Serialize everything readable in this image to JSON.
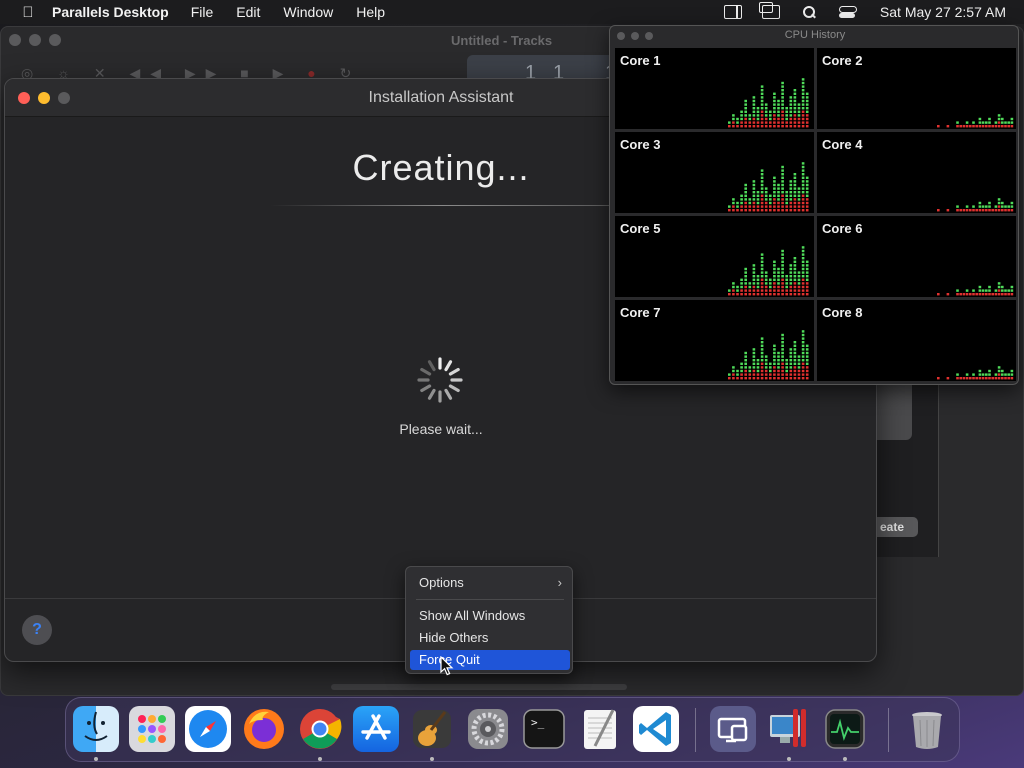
{
  "menubar": {
    "app_name": "Parallels Desktop",
    "items": [
      "File",
      "Edit",
      "Window",
      "Help"
    ],
    "clock": "Sat May 27  2:57 AM"
  },
  "background_window": {
    "title": "Untitled - Tracks",
    "lcd_values": [
      "1",
      "1",
      "1"
    ],
    "create_label": "eate"
  },
  "install_window": {
    "title": "Installation Assistant",
    "heading": "Creating...",
    "status": "Please wait...",
    "help_label": "?"
  },
  "cpu_history": {
    "title": "CPU History",
    "cores": [
      {
        "label": "Core 1",
        "load": "high"
      },
      {
        "label": "Core 2",
        "load": "low"
      },
      {
        "label": "Core 3",
        "load": "high"
      },
      {
        "label": "Core 4",
        "load": "low"
      },
      {
        "label": "Core 5",
        "load": "high"
      },
      {
        "label": "Core 6",
        "load": "low"
      },
      {
        "label": "Core 7",
        "load": "high"
      },
      {
        "label": "Core 8",
        "load": "low"
      }
    ],
    "colors": {
      "user": "#4fdb5a",
      "system": "#e0312f",
      "background": "#000000"
    }
  },
  "context_menu": {
    "items": [
      {
        "label": "Options",
        "submenu": true
      },
      {
        "label": "Show All Windows"
      },
      {
        "label": "Hide Others"
      },
      {
        "label": "Force Quit",
        "selected": true
      }
    ]
  },
  "dock": {
    "apps": [
      {
        "name": "finder-icon",
        "running": true
      },
      {
        "name": "launchpad-icon",
        "running": false
      },
      {
        "name": "safari-icon",
        "running": false
      },
      {
        "name": "firefox-icon",
        "running": false
      },
      {
        "name": "chrome-icon",
        "running": true
      },
      {
        "name": "app-store-icon",
        "running": false
      },
      {
        "name": "garageband-icon",
        "running": true
      },
      {
        "name": "system-preferences-icon",
        "running": false
      },
      {
        "name": "terminal-icon",
        "running": false
      },
      {
        "name": "textedit-icon",
        "running": false
      },
      {
        "name": "vscode-icon",
        "running": false
      },
      {
        "name": "parallels-control-center-icon",
        "running": false
      },
      {
        "name": "parallels-desktop-icon",
        "running": true
      },
      {
        "name": "activity-monitor-icon",
        "running": true
      },
      {
        "name": "trash-icon",
        "running": false
      }
    ]
  }
}
